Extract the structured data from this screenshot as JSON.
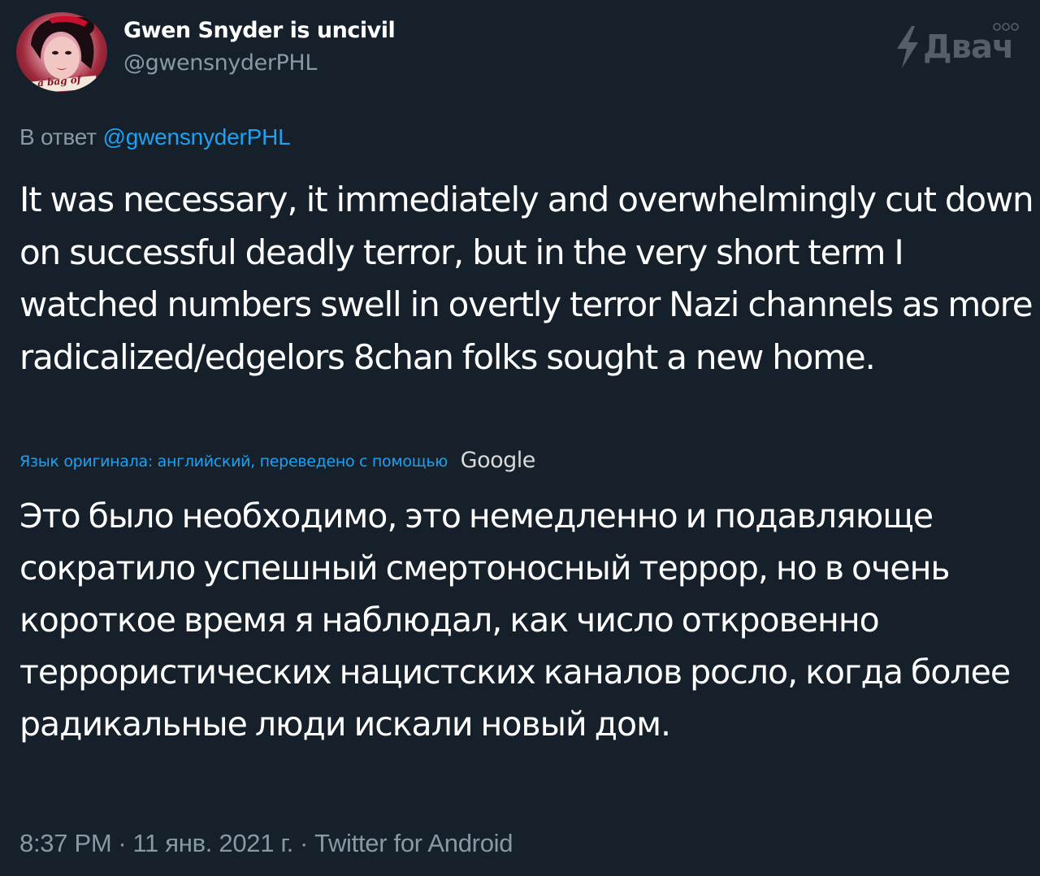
{
  "author": {
    "display_name": "Gwen Snyder is uncivil",
    "handle": "@gwensnyderPHL",
    "avatar_caption": "a bag of"
  },
  "watermark": {
    "text": "Двач",
    "logo_icon": "lightning-bolt-icon"
  },
  "reply": {
    "prefix": "В ответ",
    "mention": "@gwensnyderPHL"
  },
  "tweet": {
    "text": "It was necessary, it immediately and overwhelmingly cut down on successful deadly terror, but in the very short term I watched numbers swell in overtly terror Nazi channels as more radicalized/edgelors 8chan folks sought a new home."
  },
  "translation": {
    "note": "Язык оригинала: английский, переведено с помощью",
    "provider": "Google",
    "text": "Это было необходимо, это немедленно и подавляюще сократило успешный смертоносный террор, но в очень короткое время я наблюдал, как число откровенно террористических нацистских каналов росло, когда более радикальные люди искали новый дом."
  },
  "meta": {
    "time": "8:37 PM",
    "date": "11 янв. 2021 г.",
    "source": "Twitter for Android",
    "separator": "·"
  },
  "colors": {
    "background": "#15202b",
    "text_primary": "#ffffff",
    "text_secondary": "#8899a6",
    "accent": "#1da1f2"
  }
}
